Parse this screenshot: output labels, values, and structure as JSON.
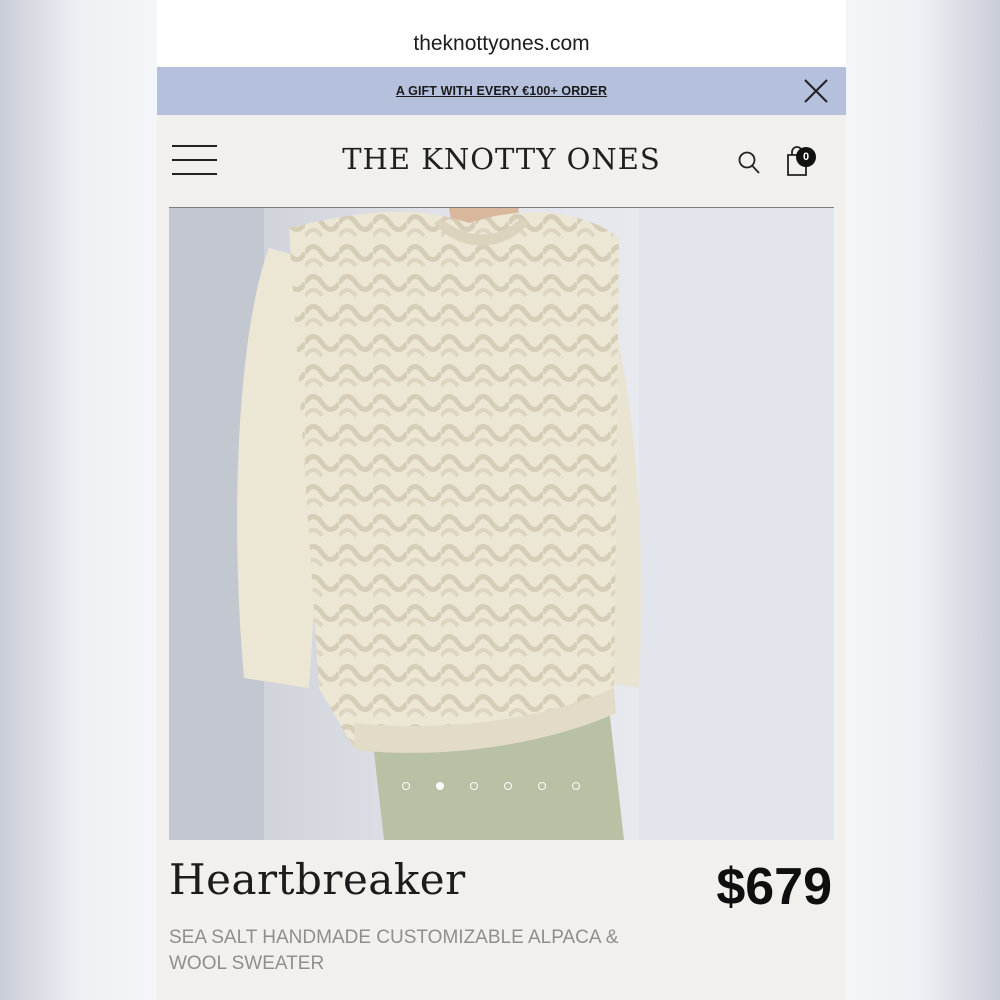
{
  "browser": {
    "url": "theknottyones.com"
  },
  "promo": {
    "text": "A GIFT WITH EVERY €100+ ORDER"
  },
  "header": {
    "logo": "THE KNOTTY ONES",
    "cart_count": "0"
  },
  "gallery": {
    "slide_count": 6,
    "active_index": 1
  },
  "product": {
    "name": "Heartbreaker",
    "price": "$679",
    "description": "SEA SALT HANDMADE CUSTOMIZABLE ALPACA & WOOL SWEATER"
  },
  "colors": {
    "promo_bg": "#b4c0dc",
    "page_bg": "#f1f0ec",
    "sweater": "#eee8d8",
    "skirt": "#b9c1a5"
  },
  "icons": [
    "close-icon",
    "hamburger-menu-icon",
    "search-icon",
    "cart-bag-icon"
  ]
}
